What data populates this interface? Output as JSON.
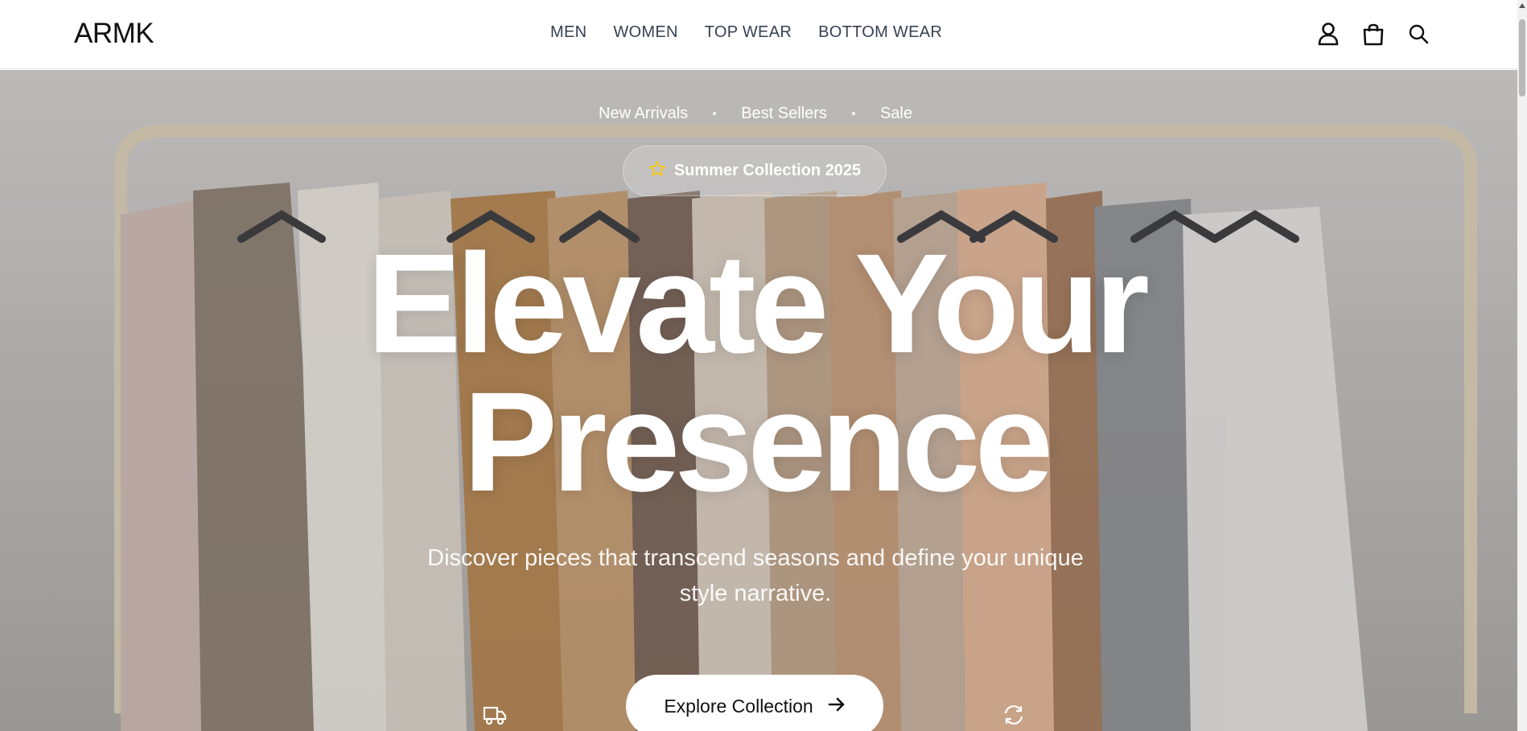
{
  "header": {
    "brand": "ARMK",
    "nav": [
      {
        "label": "MEN"
      },
      {
        "label": "WOMEN"
      },
      {
        "label": "TOP WEAR"
      },
      {
        "label": "BOTTOM WEAR"
      }
    ],
    "icons": [
      "user-icon",
      "shopping-bag-icon",
      "search-icon"
    ]
  },
  "hero": {
    "quick_links": [
      {
        "label": "New Arrivals"
      },
      {
        "label": "Best Sellers"
      },
      {
        "label": "Sale"
      }
    ],
    "badge": {
      "icon": "star-icon",
      "label": "Summer Collection 2025"
    },
    "headline": {
      "line1": "Elevate Your",
      "line2": "Presence"
    },
    "subtitle": "Discover pieces that transcend seasons and define your unique style narrative.",
    "cta": {
      "label": "Explore Collection",
      "icon": "arrow-right-icon"
    },
    "feature_icons": [
      "truck-icon",
      "refresh-icon"
    ]
  },
  "colors": {
    "accent_star": "#f5c518",
    "nav_text": "#374151",
    "cta_bg": "#ffffff"
  }
}
